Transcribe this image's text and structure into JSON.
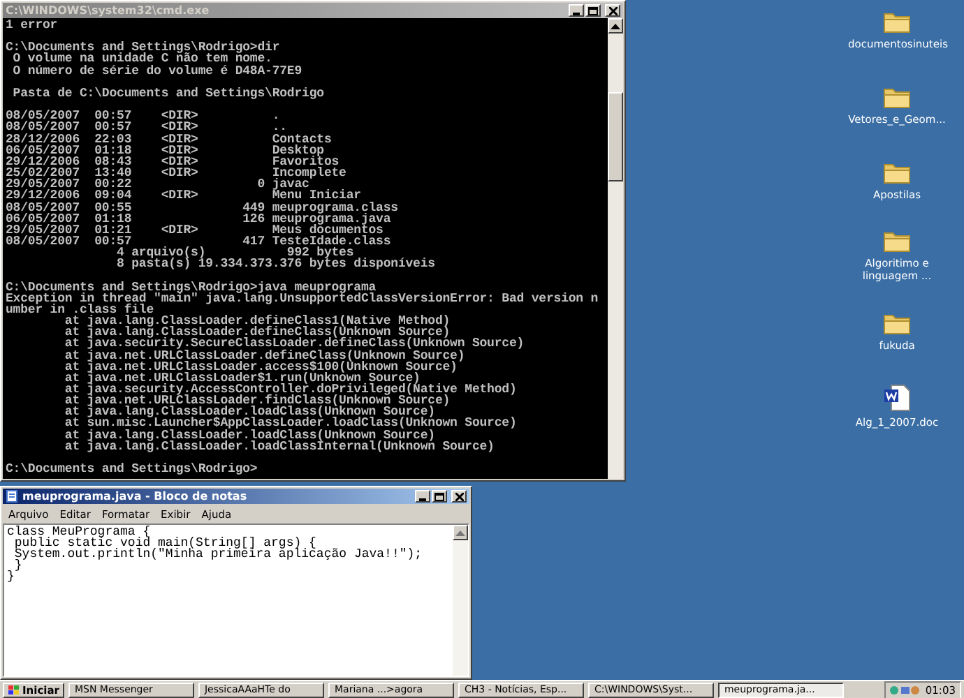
{
  "console_window": {
    "title": "C:\\WINDOWS\\system32\\cmd.exe",
    "active": false,
    "text": "1 error\n\nC:\\Documents and Settings\\Rodrigo>dir\n O volume na unidade C não tem nome.\n O número de série do volume é D48A-77E9\n\n Pasta de C:\\Documents and Settings\\Rodrigo\n\n08/05/2007  00:57    <DIR>          .\n08/05/2007  00:57    <DIR>          ..\n28/12/2006  22:03    <DIR>          Contacts\n06/05/2007  01:18    <DIR>          Desktop\n29/12/2006  08:43    <DIR>          Favoritos\n25/02/2007  13:40    <DIR>          Incomplete\n29/05/2007  00:22                 0 javac\n29/12/2006  09:04    <DIR>          Menu Iniciar\n08/05/2007  00:55               449 meuprograma.class\n06/05/2007  01:18               126 meuprograma.java\n29/05/2007  01:21    <DIR>          Meus documentos\n08/05/2007  00:57               417 TesteIdade.class\n               4 arquivo(s)           992 bytes\n               8 pasta(s) 19.334.373.376 bytes disponíveis\n\nC:\\Documents and Settings\\Rodrigo>java meuprograma\nException in thread \"main\" java.lang.UnsupportedClassVersionError: Bad version n\number in .class file\n        at java.lang.ClassLoader.defineClass1(Native Method)\n        at java.lang.ClassLoader.defineClass(Unknown Source)\n        at java.security.SecureClassLoader.defineClass(Unknown Source)\n        at java.net.URLClassLoader.defineClass(Unknown Source)\n        at java.net.URLClassLoader.access$100(Unknown Source)\n        at java.net.URLClassLoader$1.run(Unknown Source)\n        at java.security.AccessController.doPrivileged(Native Method)\n        at java.net.URLClassLoader.findClass(Unknown Source)\n        at java.lang.ClassLoader.loadClass(Unknown Source)\n        at sun.misc.Launcher$AppClassLoader.loadClass(Unknown Source)\n        at java.lang.ClassLoader.loadClass(Unknown Source)\n        at java.lang.ClassLoader.loadClassInternal(Unknown Source)\n\nC:\\Documents and Settings\\Rodrigo>"
  },
  "notepad_window": {
    "title": "meuprograma.java - Bloco de notas",
    "active": true,
    "menu": [
      "Arquivo",
      "Editar",
      "Formatar",
      "Exibir",
      "Ajuda"
    ],
    "text": "class MeuPrograma {\n public static void main(String[] args) {\n System.out.println(\"Minha primeira aplicação Java!!\");\n }\n}"
  },
  "desktop_icons": [
    {
      "label": "documentosinuteis",
      "kind": "folder"
    },
    {
      "label": "Vetores_e_Geom...",
      "kind": "folder"
    },
    {
      "label": "Apostilas",
      "kind": "folder"
    },
    {
      "label": "Algoritimo e linguagem ...",
      "kind": "folder"
    },
    {
      "label": "fukuda",
      "kind": "folder"
    },
    {
      "label": "Alg_1_2007.doc",
      "kind": "document"
    }
  ],
  "taskbar": {
    "start_label": "Iniciar",
    "tasks": [
      {
        "label": "MSN Messenger",
        "selected": false
      },
      {
        "label": "JessicaAAaHTe do",
        "selected": false
      },
      {
        "label": "Mariana ...>agora",
        "selected": false
      },
      {
        "label": "CH3 - Notícias, Esp...",
        "selected": false
      },
      {
        "label": "C:\\WINDOWS\\Syst...",
        "selected": false
      },
      {
        "label": "meuprograma.ja...",
        "selected": true
      }
    ],
    "clock": "01:03"
  }
}
